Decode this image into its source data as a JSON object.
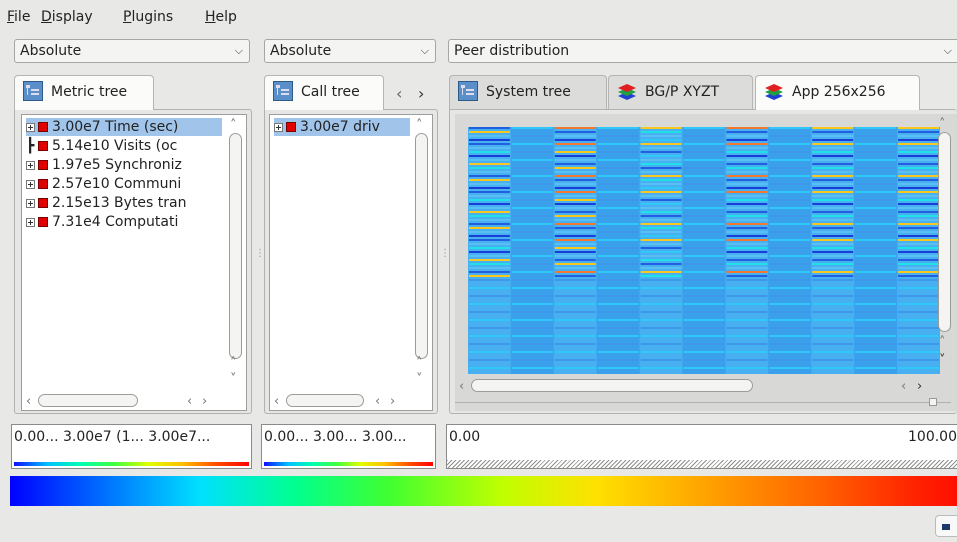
{
  "menu": [
    {
      "label": "File",
      "u": "F",
      "rest": "ile"
    },
    {
      "label": "Display",
      "u": "D",
      "rest": "isplay"
    },
    {
      "label": "Plugins",
      "u": "P",
      "rest": "lugins"
    },
    {
      "label": "Help",
      "u": "H",
      "rest": "elp"
    }
  ],
  "combos": {
    "metric_mode": "Absolute",
    "call_mode": "Absolute",
    "system_mode": "Peer distribution"
  },
  "metric_panel": {
    "tab_label": "Metric tree",
    "rows": [
      "3.00e7 Time (sec)",
      "5.14e10 Visits (oc",
      "1.97e5 Synchroniz",
      "2.57e10 Communi",
      "2.15e13 Bytes tran",
      "7.31e4 Computati"
    ],
    "value_text": "0.00... 3.00e7 (1... 3.00e7..."
  },
  "call_panel": {
    "tab_label": "Call tree",
    "rows": [
      "3.00e7 driv"
    ],
    "value_text": "0.00... 3.00... 3.00..."
  },
  "system_panel": {
    "tabs": [
      "System tree",
      "BG/P XYZT",
      "App 256x256"
    ],
    "active_tab": "App 256x256",
    "value_min": "0.00",
    "value_max": "100.00"
  },
  "colors": {
    "heat_base": "#40a8f0",
    "heat_light": "#2fc8f8",
    "heat_dark": "#2060e0",
    "heat_yellow": "#f8c820",
    "heat_orange": "#f07830",
    "heat_cyan": "#20e0e8",
    "heat_blue": "#1840d8"
  }
}
